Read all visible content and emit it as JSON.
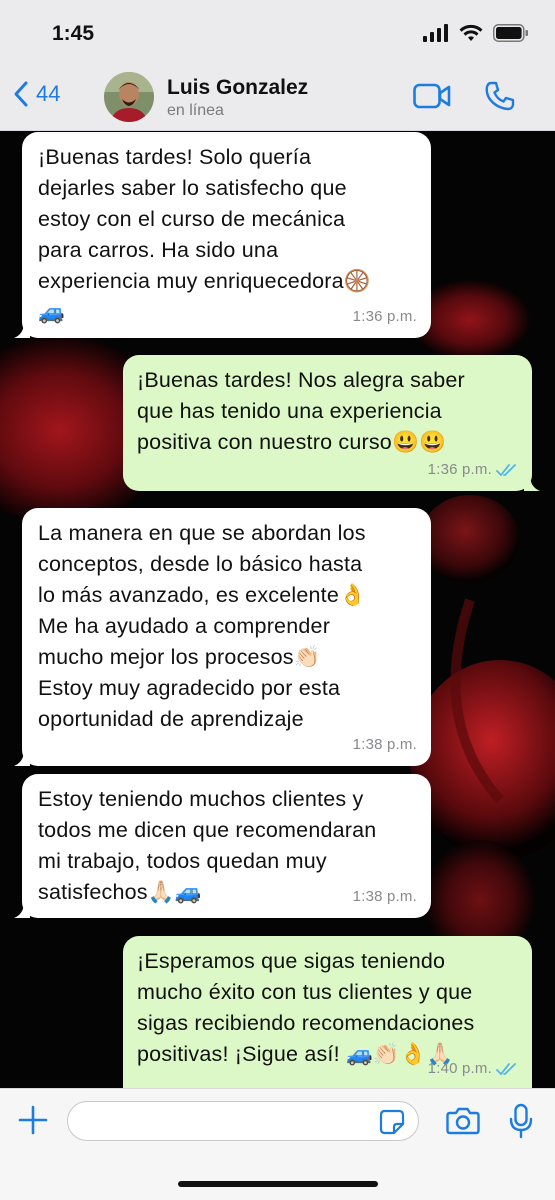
{
  "status_bar": {
    "time": "1:45"
  },
  "header": {
    "back_count": "44",
    "contact_name": "Luis Gonzalez",
    "contact_status": "en línea"
  },
  "messages": [
    {
      "direction": "in",
      "text": "¡Buenas tardes! Solo quería\ndejarles saber lo satisfecho que\nestoy con el curso de mecánica\npara carros. Ha sido una\nexperiencia muy enriquecedora🛞\n🚙",
      "time": "1:36 p.m."
    },
    {
      "direction": "out",
      "text": "¡Buenas tardes! Nos alegra saber\nque has tenido una experiencia\npositiva con nuestro curso😃😃",
      "time": "1:36 p.m."
    },
    {
      "direction": "in",
      "text": "La manera en que se abordan los\nconceptos, desde lo básico hasta\nlo más avanzado, es excelente👌\nMe ha ayudado a comprender\nmucho mejor los procesos👏🏻\nEstoy muy agradecido por esta\noportunidad de aprendizaje",
      "time": "1:38 p.m."
    },
    {
      "direction": "in",
      "text": "Estoy teniendo muchos clientes y\ntodos me dicen que recomendaran\nmi trabajo, todos quedan muy\nsatisfechos🙏🏻🚙",
      "time": "1:38 p.m."
    },
    {
      "direction": "out",
      "text": "¡Esperamos que sigas teniendo\nmucho éxito con tus clientes y que\nsigas recibiendo recomendaciones\npositivas! ¡Sigue así! 🚙👏🏻👌🙏🏻",
      "time": "1:40 p.m."
    }
  ],
  "input": {
    "placeholder": ""
  },
  "colors": {
    "accent": "#1d7ce0",
    "bubble_out": "#dcf8c6",
    "bubble_in": "#ffffff",
    "read_ticks": "#4fb6ec"
  },
  "icons": {
    "back": "chevron-left-icon",
    "video": "video-camera-icon",
    "call": "phone-icon",
    "plus": "plus-icon",
    "sticker": "sticker-icon",
    "camera": "camera-icon",
    "mic": "microphone-icon"
  }
}
